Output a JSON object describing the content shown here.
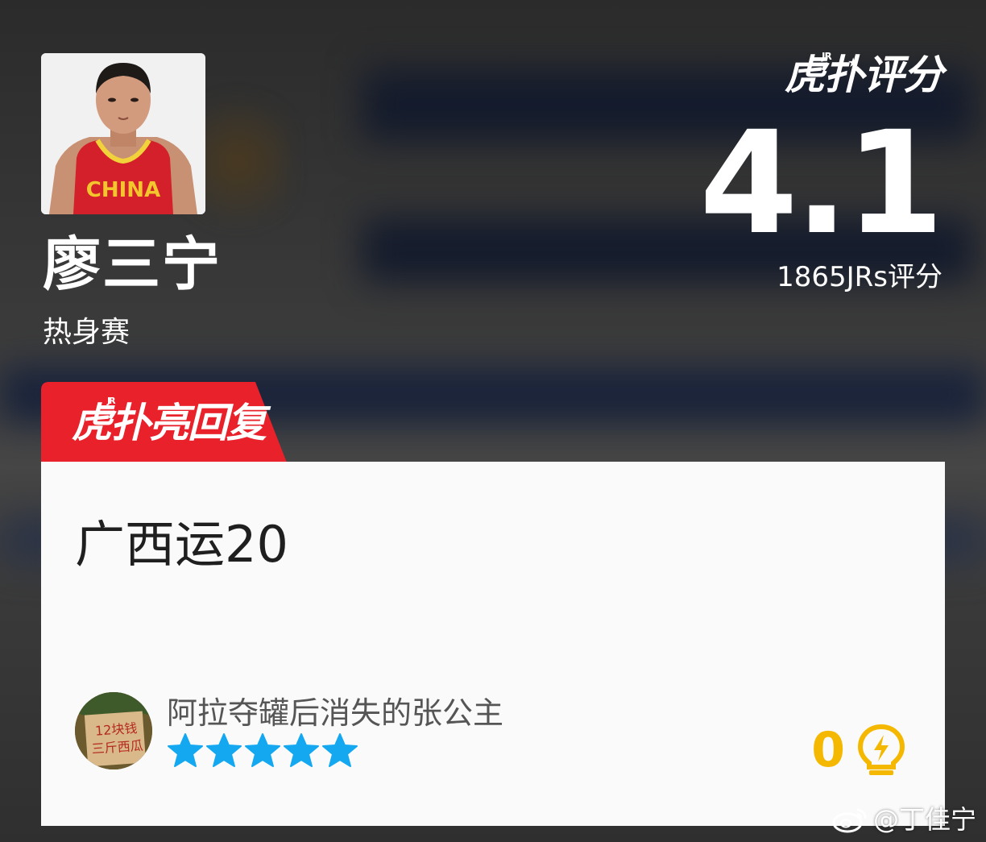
{
  "player": {
    "name": "廖三宁",
    "game_type": "热身赛",
    "jersey_text": "CHINA"
  },
  "rating": {
    "brand": "虎扑评分",
    "brand_jr": "JR",
    "score": "4.1",
    "count_text": "1865JRs评分"
  },
  "highlight": {
    "tag_label": "虎扑亮回复",
    "tag_jr": "JR",
    "tag_color": "#e8212a",
    "comment": "广西运20",
    "user": {
      "name": "阿拉夺罐后消失的张公主",
      "avatar_text_line1": "12块钱",
      "avatar_text_line2": "三斤西瓜"
    },
    "stars": 5,
    "star_color": "#14a8f0",
    "likes": "0",
    "like_color": "#f5b800"
  },
  "watermark": {
    "text": "@丁佳宁",
    "icon": "weibo-icon"
  }
}
